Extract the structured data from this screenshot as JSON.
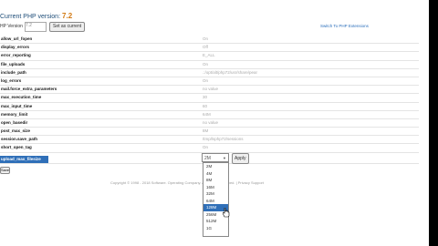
{
  "header": {
    "title_prefix": "Current PHP version:",
    "version": "7.2",
    "php_version_label": "HP Version",
    "php_select": "7.2",
    "set_button": "Set as current",
    "switch_link": "Switch To PHP Extensions"
  },
  "options": [
    {
      "name": "allow_url_fopen",
      "value": "On"
    },
    {
      "name": "display_errors",
      "value": "Off"
    },
    {
      "name": "error_reporting",
      "value": "E_ALL"
    },
    {
      "name": "file_uploads",
      "value": "On"
    },
    {
      "name": "include_path",
      "value": ".:/opt/alt/php72/usr/share/pear"
    },
    {
      "name": "log_errors",
      "value": "On"
    },
    {
      "name": "mail.force_extra_parameters",
      "value": "no value"
    },
    {
      "name": "max_execution_time",
      "value": "30"
    },
    {
      "name": "max_input_time",
      "value": "60"
    },
    {
      "name": "memory_limit",
      "value": "64M"
    },
    {
      "name": "open_basedir",
      "value": "no value"
    },
    {
      "name": "post_max_size",
      "value": "8M"
    },
    {
      "name": "session.save_path",
      "value": "/tmp/lsphp72/sessions"
    },
    {
      "name": "short_open_tag",
      "value": "On"
    }
  ],
  "selected_option": {
    "name": "upload_max_filesize",
    "value": "2M",
    "apply_button": "Apply"
  },
  "save_button": "Save",
  "footer": "Copyright © 1998 - 2018 Software. Operating Company. All Rights Reserved. | Privacy Support",
  "dropdown_options": [
    "2M",
    "4M",
    "8M",
    "16M",
    "32M",
    "64M",
    "128M",
    "256M",
    "512M",
    "1G"
  ],
  "dropdown_highlighted": "128M",
  "colors": {
    "accent": "#2f6fb8",
    "version": "#d27a14"
  }
}
